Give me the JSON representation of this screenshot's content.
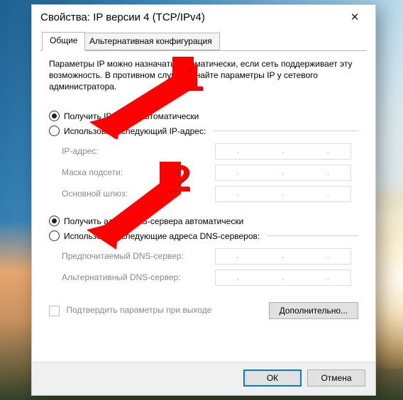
{
  "window": {
    "title": "Свойства: IP версии 4 (TCP/IPv4)",
    "close_icon": "✕"
  },
  "tabs": {
    "general": "Общие",
    "alternate": "Альтернативная конфигурация"
  },
  "intro": "Параметры IP можно назначать автоматически, если сеть поддерживает эту возможность. В противном случае узнайте параметры IP у сетевого администратора.",
  "ip": {
    "auto": "Получить IP-адрес автоматически",
    "manual": "Использовать следующий IP-адрес:",
    "fields": {
      "ip": "IP-адрес:",
      "mask": "Маска подсети:",
      "gateway": "Основной шлюз:"
    }
  },
  "dns": {
    "auto": "Получить адрес DNS-сервера автоматически",
    "manual": "Использовать следующие адреса DNS-серверов:",
    "fields": {
      "preferred": "Предпочитаемый DNS-сервер:",
      "alternate": "Альтернативный DNS-сервер:"
    }
  },
  "validate": "Подтвердить параметры при выходе",
  "advanced": "Дополнительно...",
  "buttons": {
    "ok": "ОК",
    "cancel": "Отмена"
  },
  "annotations": {
    "one": "1",
    "two": "2"
  }
}
